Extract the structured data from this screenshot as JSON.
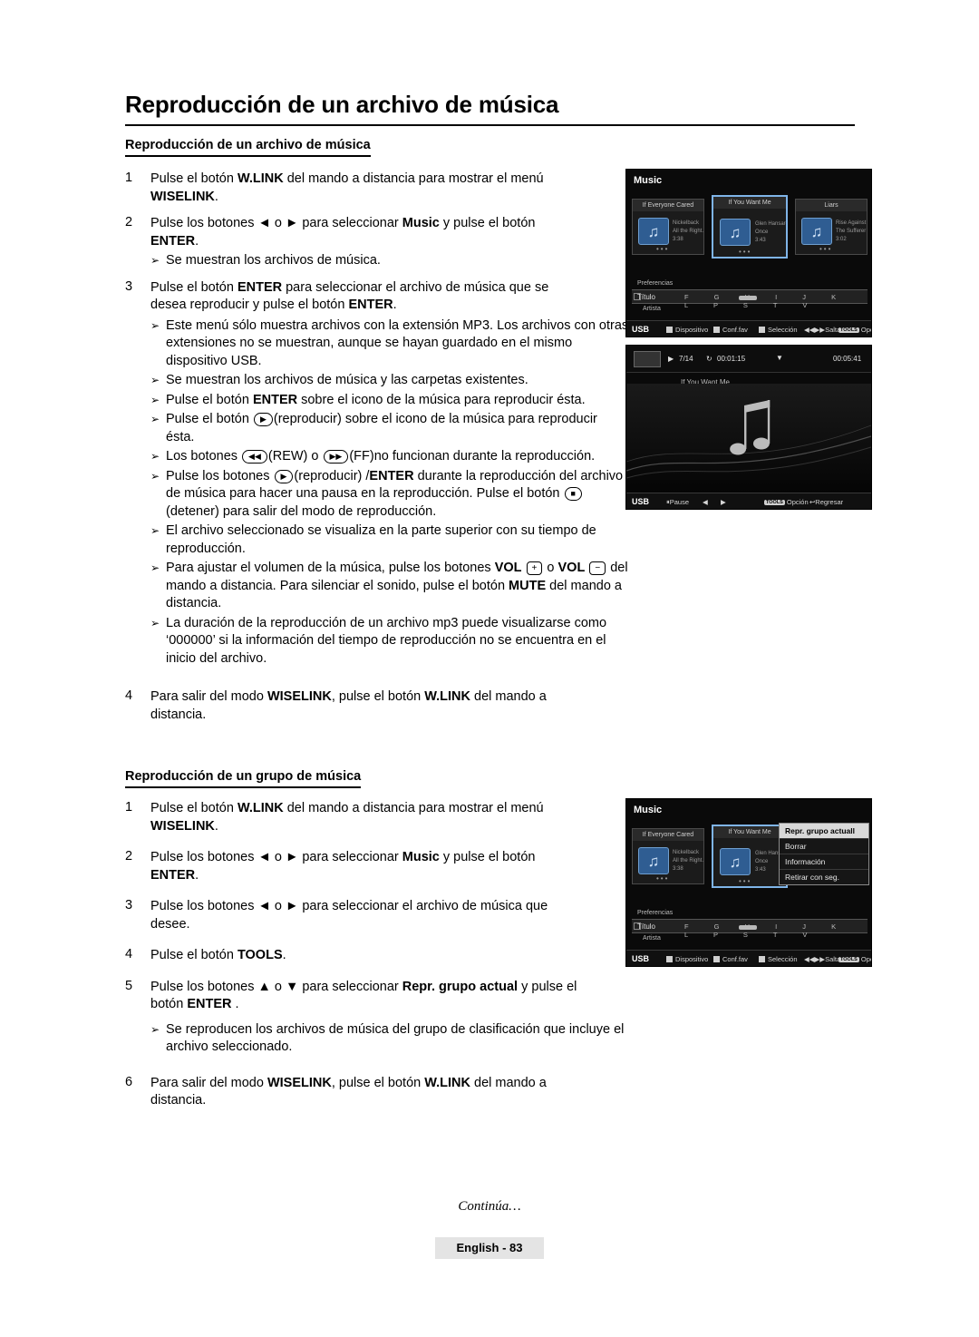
{
  "page": {
    "title": "Reproducción de un archivo de música",
    "footer_note": "Continúa…",
    "page_label": "English - 83"
  },
  "section1": {
    "heading": "Reproducción de un archivo de música",
    "steps": [
      {
        "num": "1",
        "html": "Pulse el botón <b>W.LINK</b> del mando a distancia para mostrar el menú <b>WISELINK</b>."
      },
      {
        "num": "2",
        "html": "Pulse los botones ◄ o ► para seleccionar <b>Music</b> y pulse el botón <b>ENTER</b>."
      },
      {
        "num": "3",
        "html": "Pulse el botón <b>ENTER</b> para seleccionar el archivo de música que se desea reproducir y pulse el botón <b>ENTER</b>."
      },
      {
        "num": "4",
        "html": "Para salir del modo <b>WISELINK</b>, pulse el botón <b>W.LINK</b> del mando a distancia."
      }
    ],
    "bullet_after_2": "Se muestran los archivos de música.",
    "bullets_after_3": [
      "Este menú sólo muestra archivos con la extensión MP3. Los archivos con otras extensiones no se muestran, aunque se hayan guardado en el mismo dispositivo USB.",
      "Se muestran los archivos de música y las carpetas existentes.",
      "Pulse el botón ENTER sobre el icono de la música para reproducir ésta.",
      "Pulse el botón (reproducir) sobre el icono de la música para reproducir ésta.",
      "Los botones (REW) o (FF)no funcionan durante la reproducción.",
      "Pulse los botones (reproducir) /ENTER durante la reproducción del archivo de música para hacer una pausa en la reproducción. Pulse el botón (detener) para salir del modo de reproducción.",
      "El archivo seleccionado se visualiza en la parte superior con su tiempo de reproducción.",
      "Para ajustar el volumen de la música, pulse los botones VOL + o VOL − del mando a distancia. Para silenciar el sonido, pulse el botón MUTE del mando a distancia.",
      "La duración de la reproducción de un archivo mp3 puede visualizarse como ‘000000’ si la información del tiempo de reproducción no se encuentra en el inicio del archivo."
    ]
  },
  "section2": {
    "heading": "Reproducción de un grupo de música",
    "steps": [
      {
        "num": "1",
        "html": "Pulse el botón <b>W.LINK</b> del mando a distancia para mostrar el menú <b>WISELINK</b>."
      },
      {
        "num": "2",
        "html": "Pulse los botones ◄ o ► para seleccionar <b>Music</b> y pulse el botón <b>ENTER</b>."
      },
      {
        "num": "3",
        "html": "Pulse los botones ◄ o ► para seleccionar el archivo de música que desee."
      },
      {
        "num": "4",
        "html": "Pulse el botón <b>TOOLS</b>."
      },
      {
        "num": "5",
        "html": "Pulse los botones ▲ o ▼ para seleccionar <b>Repr. grupo actual</b> y pulse el botón <b>ENTER</b> ."
      },
      {
        "num": "6",
        "html": "Para salir del modo <b>WISELINK</b>, pulse el botón <b>W.LINK</b> del mando a distancia."
      }
    ],
    "bullet_after_5": "Se reproducen los archivos de música del grupo de clasificación que incluye el archivo seleccionado."
  },
  "screens": {
    "music_list": {
      "title": "Music",
      "thumbs": [
        {
          "caption": "If Everyone Cared",
          "line1": "Nickelback",
          "line2": "All the Right...",
          "line3": "3:38"
        },
        {
          "caption": "If You Want Me",
          "line1": "Glen Hansard &...",
          "line2": "Once",
          "line3": "3:43"
        },
        {
          "caption": "Liars",
          "line1": "Rise Against",
          "line2": "The Sufferer &...",
          "line3": "3:02"
        }
      ],
      "preferences_label": "Preferencias",
      "sort_label": "Título",
      "sort_letters": "F G H I J K L P S T V",
      "artist_label": "Artista",
      "bottom": {
        "source": "USB",
        "device": "Dispositivo",
        "config": "Conf.fav",
        "select": "Selección",
        "jump": "Saltar",
        "tools": "TOOLS",
        "option": "Opción"
      }
    },
    "player": {
      "track_index": "7/14",
      "elapsed": "00:01:15",
      "total": "00:05:41",
      "now_playing": "If You Want Me",
      "bottom": {
        "source": "USB",
        "pause": "Pause",
        "tools": "TOOLS",
        "option": "Opción",
        "back": "Regresar"
      }
    },
    "music_tools": {
      "title": "Music",
      "thumbs": [
        {
          "caption": "If Everyone Cared",
          "line1": "Nickelback",
          "line2": "All the Right...",
          "line3": "3:38"
        },
        {
          "caption": "If You Want Me",
          "line1": "Glen Hansard &...",
          "line2": "Once",
          "line3": "3:43"
        }
      ],
      "menu_items": [
        "Repr. grupo actuall",
        "Borrar",
        "Información",
        "Retirar con seg."
      ],
      "preferences_label": "Preferencias",
      "sort_label": "Título",
      "sort_letters": "F G H I J K L P S T V",
      "artist_label": "Artista",
      "bottom": {
        "source": "USB",
        "device": "Dispositivo",
        "config": "Conf.fav",
        "select": "Selección",
        "jump": "Saltar",
        "tools": "TOOLS",
        "option": "Opción"
      }
    }
  }
}
